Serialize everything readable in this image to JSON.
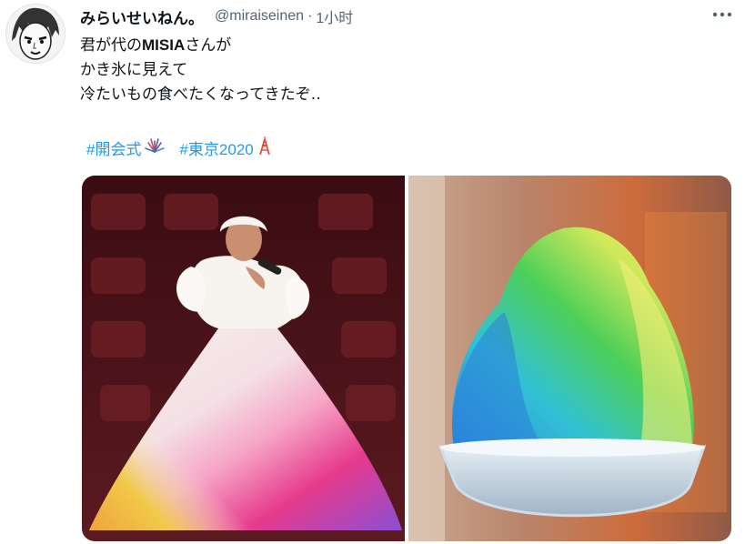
{
  "tweet": {
    "author": {
      "display_name": "みらいせいねん。",
      "handle": "@miraiseinen",
      "avatar_icon": "manga-face-avatar-icon"
    },
    "separator": "·",
    "time": "1小时",
    "more_icon": "more-dots-icon",
    "body": {
      "line1_before": "君が代の",
      "line1_bold": "MISIA",
      "line1_after": "さんが",
      "line2": "かき氷に見えて",
      "line3": "冷たいもの食べたくなってきたぞ‥"
    },
    "hashtags": [
      {
        "label": "#開会式",
        "emoji_icon": "fireworks-icon"
      },
      {
        "label": "#東京2020",
        "emoji_icon": "tokyo-tower-icon"
      }
    ],
    "media": [
      {
        "icon": "singer-rainbow-dress-photo"
      },
      {
        "icon": "rainbow-shaved-ice-photo"
      }
    ]
  },
  "colors": {
    "text": "#0f1419",
    "secondary": "#536471",
    "link": "#1d9bf0"
  }
}
